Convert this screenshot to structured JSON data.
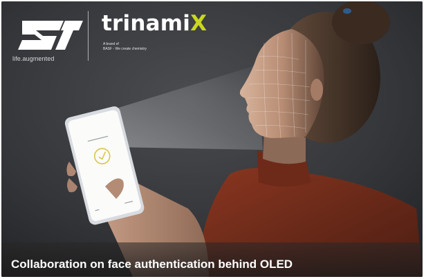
{
  "logos": {
    "st_tagline": "life.augmented",
    "brand_name": "trinami",
    "brand_accent": "X",
    "brand_subline_1": "A brand of",
    "brand_subline_2": "BASF - We create chemistry"
  },
  "caption": "Collaboration on face authentication behind OLED",
  "colors": {
    "background": "#2f3135",
    "brand_accent": "#c8d81e",
    "sweater": "#7a2e1c",
    "caption_text": "#ffffff"
  }
}
